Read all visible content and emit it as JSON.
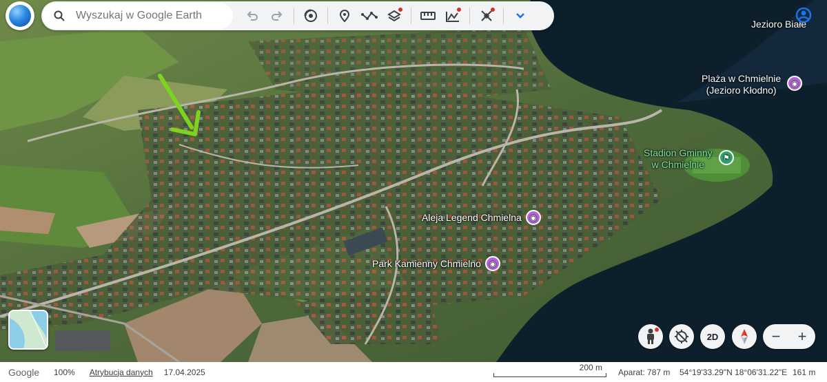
{
  "toolbar": {
    "search_placeholder": "Wyszukaj w Google Earth",
    "icons": [
      "undo-icon",
      "redo-icon",
      "voyager-icon",
      "placemark-icon",
      "path-icon",
      "layers-icon",
      "measure-icon",
      "elevation-icon",
      "sync-icon",
      "chevron-down-icon"
    ]
  },
  "map": {
    "labels": {
      "lake": "Jezioro Białe",
      "beach_line1": "Plaża w Chmielnie",
      "beach_line2": "(Jezioro Kłodno)",
      "stadium_line1": "Stadion Gminny",
      "stadium_line2": "w Chmielnie",
      "alley": "Aleja Legend Chmielna",
      "park": "Park Kamienny Chmielno"
    },
    "colors": {
      "pin_photo": "#b565d9",
      "pin_stadium": "#2fa46a",
      "arrow": "#7ed321",
      "water": "#0e1f2c"
    }
  },
  "controls": {
    "mode_2d": "2D",
    "zoom_out": "−",
    "zoom_in": "+"
  },
  "status": {
    "brand": "Google",
    "zoom": "100%",
    "attribution": "Atrybucja danych",
    "date": "17.04.2025",
    "scale": "200 m",
    "camera": "Aparat: 787 m",
    "coords": "54°19'33.29\"N 18°06'31.22\"E",
    "elevation": "161 m"
  }
}
